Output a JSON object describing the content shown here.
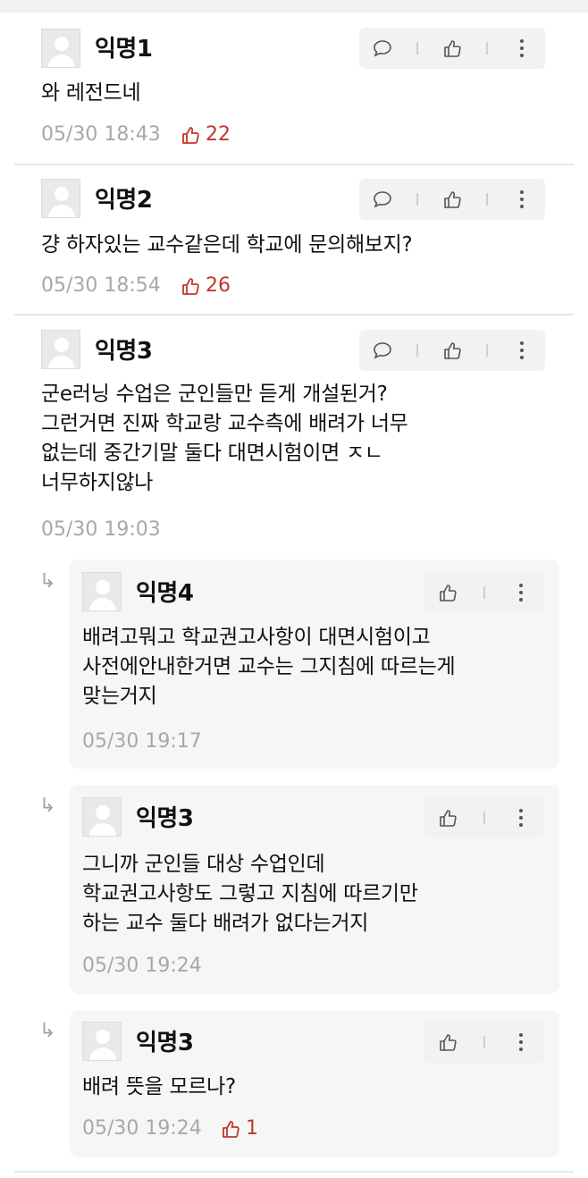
{
  "comments": [
    {
      "author": "익명1",
      "text": "와 레전드네",
      "time": "05/30 18:43",
      "likes": "22"
    },
    {
      "author": "익명2",
      "text": "걍 하자있는 교수같은데 학교에 문의해보지?",
      "time": "05/30 18:54",
      "likes": "26"
    },
    {
      "author": "익명3",
      "text": "군e러닝 수업은 군인들만 듣게 개설된거?\n그런거면 진짜 학교랑 교수측에 배려가 너무\n없는데 중간기말 둘다 대면시험이면 ㅈㄴ\n너무하지않나",
      "time": "05/30 19:03",
      "likes": ""
    }
  ],
  "replies": [
    {
      "author": "익명4",
      "text": "배려고뭐고 학교권고사항이 대면시험이고\n사전에안내한거면 교수는 그지침에 따르는게\n맞는거지",
      "time": "05/30 19:17",
      "likes": ""
    },
    {
      "author": "익명3",
      "text": "그니까 군인들 대상 수업인데\n학교권고사항도 그렇고 지침에 따르기만\n하는 교수 둘다 배려가 없다는거지",
      "time": "05/30 19:24",
      "likes": ""
    },
    {
      "author": "익명3",
      "text": "배려 뜻을 모르나?",
      "time": "05/30 19:24",
      "likes": "1"
    }
  ],
  "reply_arrow": "↳",
  "icons": {
    "reply": "speech-bubble-icon",
    "like": "thumbs-up-icon",
    "more": "more-vertical-icon",
    "avatar": "anonymous-avatar-icon"
  },
  "colors": {
    "like_red": "#c0392b",
    "meta_gray": "#a8a8a8",
    "reply_bg": "#f6f6f6",
    "action_bg": "#f2f2f2"
  }
}
